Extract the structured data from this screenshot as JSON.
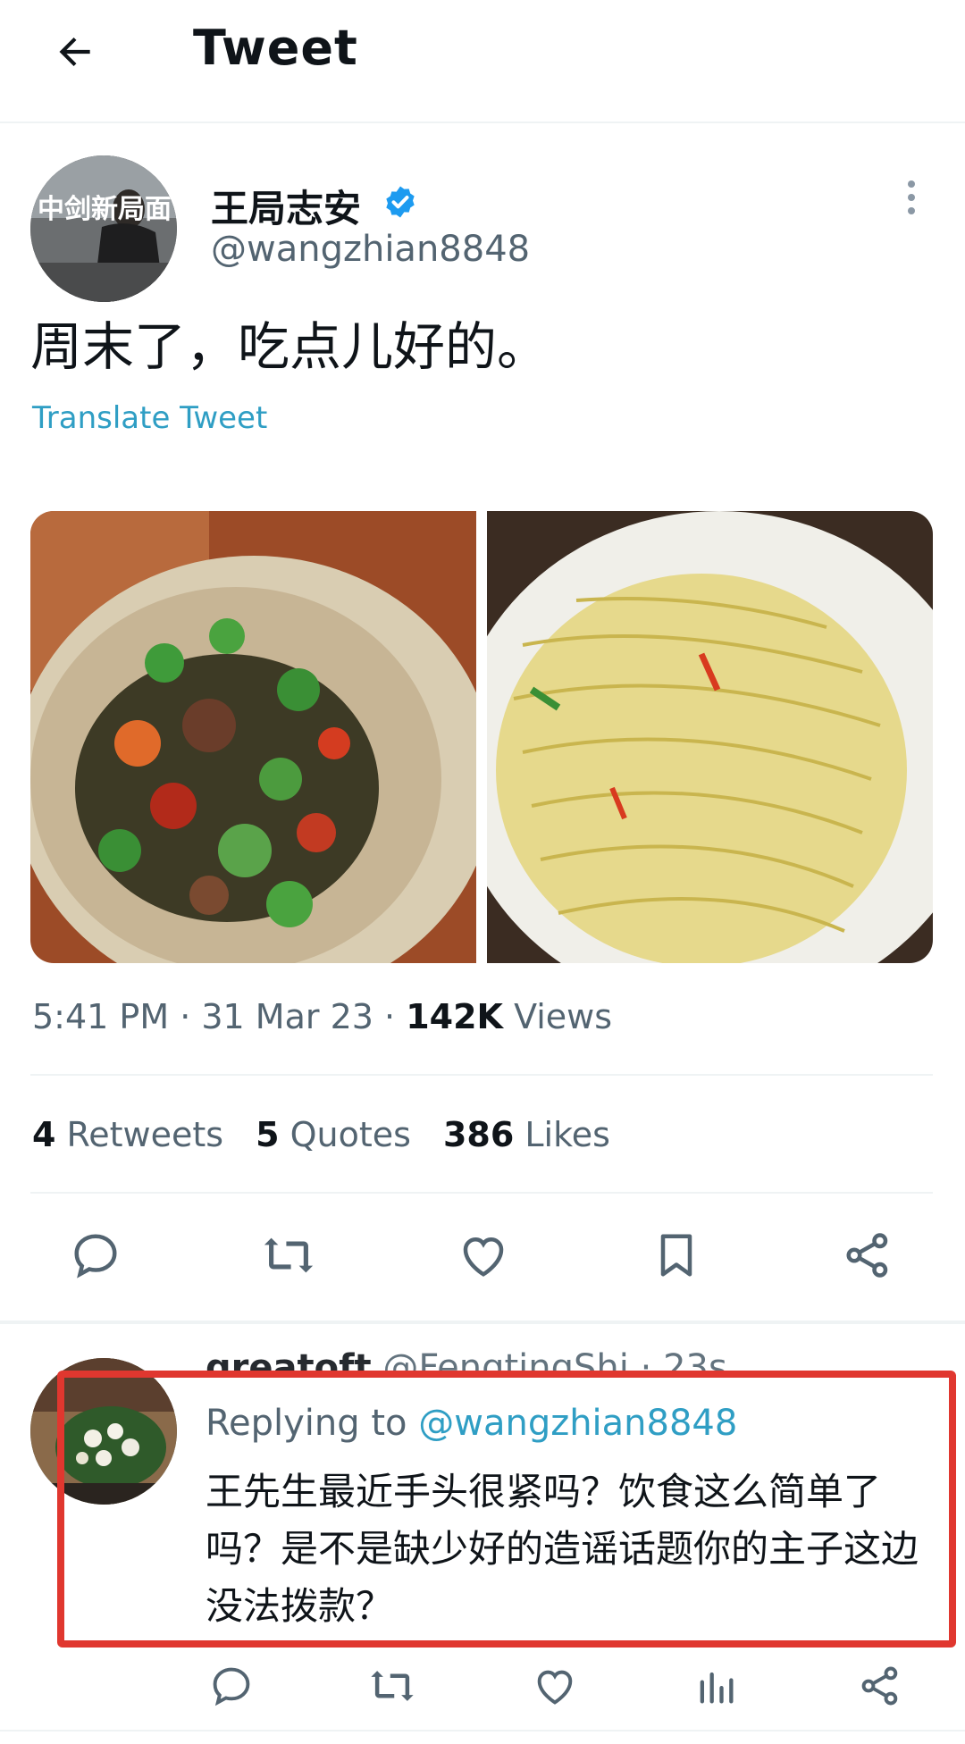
{
  "header": {
    "title": "Tweet"
  },
  "author": {
    "name": "王局志安",
    "handle": "@wangzhian8848",
    "avatar_text": "中剑新局面"
  },
  "tweet": {
    "text": "周末了，吃点儿好的。",
    "translate": "Translate Tweet",
    "time": "5:41 PM",
    "date": "31 Mar 23",
    "views_count": "142K",
    "views_label": "Views"
  },
  "stats": {
    "retweets_count": "4",
    "retweets_label": "Retweets",
    "quotes_count": "5",
    "quotes_label": "Quotes",
    "likes_count": "386",
    "likes_label": "Likes"
  },
  "reply": {
    "name": "greatoft",
    "handle": "@FengtingShi",
    "time": "23s",
    "replying_prefix": "Replying to",
    "replying_handle": "@wangzhian8848",
    "text": "王先生最近手头很紧吗？饮食这么简单了吗？是不是缺少好的造谣话题你的主子这边没法拨款？"
  },
  "colors": {
    "accent": "#1d9bf0",
    "highlight": "#e0372f",
    "secondary_text": "#536471"
  }
}
